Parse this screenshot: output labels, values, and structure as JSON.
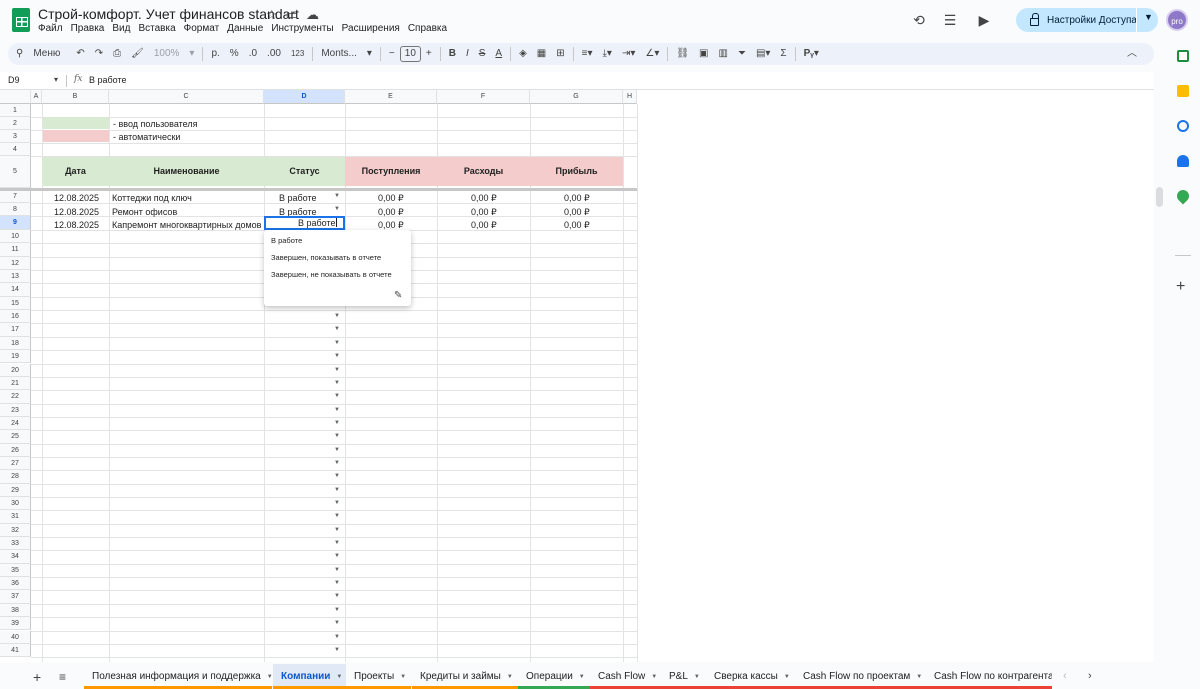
{
  "doc": {
    "title": "Строй-комфорт. Учет финансов standart",
    "menu": [
      "Файл",
      "Правка",
      "Вид",
      "Вставка",
      "Формат",
      "Данные",
      "Инструменты",
      "Расширения",
      "Справка"
    ],
    "share_label": "Настройки Доступа",
    "avatar_text": "pro"
  },
  "toolbar": {
    "menu_label": "Меню",
    "zoom": "100%",
    "currency": "р.",
    "percent": "%",
    "dec_less": ".0",
    "dec_more": ".00",
    "number_format": "123",
    "font": "Monts...",
    "font_size": "10",
    "bold": "B",
    "italic": "I",
    "strike": "S",
    "text_color": "A",
    "sum": "Σ"
  },
  "formula_bar": {
    "cell_ref": "D9",
    "fx": "fx",
    "value": "В работе"
  },
  "columns": [
    "A",
    "B",
    "C",
    "D",
    "E",
    "F",
    "G",
    "H"
  ],
  "rows": [
    "1",
    "2",
    "3",
    "4",
    "5",
    "7",
    "8",
    "9",
    "10",
    "11",
    "12",
    "13",
    "14",
    "15",
    "16",
    "17",
    "18",
    "19",
    "20",
    "21",
    "22",
    "23",
    "24",
    "25",
    "26",
    "27",
    "28",
    "29",
    "30",
    "31",
    "32",
    "33",
    "34",
    "35",
    "36",
    "37",
    "38",
    "39",
    "40",
    "41"
  ],
  "legend": {
    "user_input": "- ввод пользователя",
    "automatic": "- автоматически",
    "user_color": "#d9ead3",
    "auto_color": "#f4cccc"
  },
  "table": {
    "headers": [
      "Дата",
      "Наименование",
      "Статус",
      "Поступления",
      "Расходы",
      "Прибыль"
    ],
    "rows": [
      {
        "date": "12.08.2025",
        "name": "Коттеджи под ключ",
        "status": "В работе",
        "income": "0,00 ₽",
        "expense": "0,00 ₽",
        "profit": "0,00 ₽"
      },
      {
        "date": "12.08.2025",
        "name": "Ремонт офисов",
        "status": "В работе",
        "income": "0,00 ₽",
        "expense": "0,00 ₽",
        "profit": "0,00 ₽"
      },
      {
        "date": "12.08.2025",
        "name": "Капремонт многоквартирных домов",
        "status": "В работе",
        "income": "0,00 ₽",
        "expense": "0,00 ₽",
        "profit": "0,00 ₽"
      }
    ]
  },
  "editing_value": "В работе",
  "dropdown": {
    "options": [
      "В работе",
      "Завершен, показывать в отчете",
      "Завершен, не показывать в отчете"
    ]
  },
  "tabs": [
    {
      "label": "Полезная информация и поддержка",
      "color": "#ff9800"
    },
    {
      "label": "Компании",
      "color": "#ff9800",
      "active": true
    },
    {
      "label": "Проекты",
      "color": "#ff9800"
    },
    {
      "label": "Кредиты и займы",
      "color": "#ff9800"
    },
    {
      "label": "Операции",
      "color": "#34a853"
    },
    {
      "label": "Cash Flow",
      "color": "#ea4335"
    },
    {
      "label": "P&L",
      "color": "#ea4335"
    },
    {
      "label": "Сверка кассы",
      "color": "#ea4335"
    },
    {
      "label": "Cash Flow по проектам",
      "color": "#ea4335"
    },
    {
      "label": "Cash Flow по контрагентам",
      "color": "#ea4335"
    }
  ]
}
